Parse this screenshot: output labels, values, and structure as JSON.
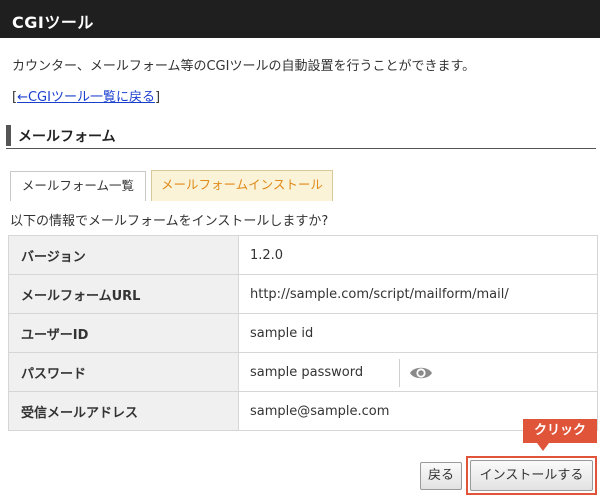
{
  "header": {
    "title": "CGIツール"
  },
  "description": "カウンター、メールフォーム等のCGIツールの自動設置を行うことができます。",
  "back_link": {
    "bracket_open": "[",
    "label": "←CGIツール一覧に戻る",
    "bracket_close": "]"
  },
  "section": {
    "title": "メールフォーム"
  },
  "tabs": [
    {
      "label": "メールフォーム一覧",
      "active": false
    },
    {
      "label": "メールフォームインストール",
      "active": true
    }
  ],
  "question": "以下の情報でメールフォームをインストールしますか?",
  "rows": [
    {
      "label": "バージョン",
      "value": "1.2.0"
    },
    {
      "label": "メールフォームURL",
      "value": "http://sample.com/script/mailform/mail/"
    },
    {
      "label": "ユーザーID",
      "value": "sample id"
    },
    {
      "label": "パスワード",
      "value": "sample password"
    },
    {
      "label": "受信メールアドレス",
      "value": "sample@sample.com"
    }
  ],
  "annotation": {
    "label": "クリック"
  },
  "buttons": {
    "back_label": "戻る",
    "install_label": "インストールする"
  },
  "colors": {
    "header_bg": "#1f1f1f",
    "active_tab_text": "#e08a1a",
    "highlight": "#e0553a",
    "link": "#1a3fcf"
  },
  "icons": {
    "password_toggle": "eye-icon"
  }
}
